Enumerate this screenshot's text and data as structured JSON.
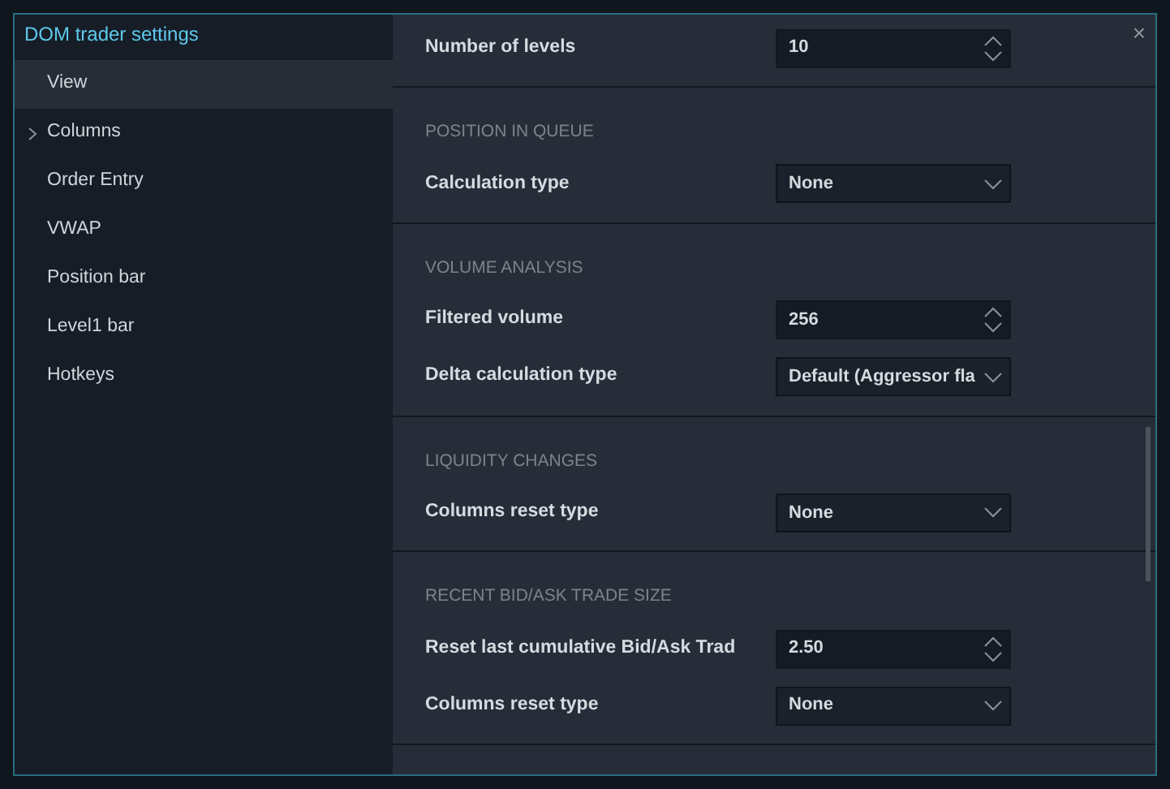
{
  "dialog": {
    "title": "DOM trader settings",
    "close": "×"
  },
  "sidebar": {
    "items": [
      {
        "label": "View",
        "selected": true,
        "expandable": false
      },
      {
        "label": "Columns",
        "selected": false,
        "expandable": true
      },
      {
        "label": "Order Entry",
        "selected": false,
        "expandable": false
      },
      {
        "label": "VWAP",
        "selected": false,
        "expandable": false
      },
      {
        "label": "Position bar",
        "selected": false,
        "expandable": false
      },
      {
        "label": "Level1 bar",
        "selected": false,
        "expandable": false
      },
      {
        "label": "Hotkeys",
        "selected": false,
        "expandable": false
      }
    ]
  },
  "sections": [
    {
      "fields": [
        {
          "label": "Number of levels",
          "kind": "spinner",
          "value": "10"
        }
      ]
    },
    {
      "header": "POSITION IN QUEUE",
      "fields": [
        {
          "label": "Calculation type",
          "kind": "dropdown",
          "value": "None"
        }
      ]
    },
    {
      "header": "VOLUME ANALYSIS",
      "fields": [
        {
          "label": "Filtered volume",
          "kind": "spinner",
          "value": "256"
        },
        {
          "label": "Delta calculation type",
          "kind": "dropdown",
          "value": "Default (Aggressor fla"
        }
      ]
    },
    {
      "header": "LIQUIDITY CHANGES",
      "fields": [
        {
          "label": "Columns reset type",
          "kind": "dropdown",
          "value": "None"
        }
      ]
    },
    {
      "header": "RECENT BID/ASK TRADE SIZE",
      "fields": [
        {
          "label": "Reset last cumulative Bid/Ask Trad",
          "kind": "spinner",
          "value": "2.50"
        },
        {
          "label": "Columns reset type",
          "kind": "dropdown",
          "value": "None"
        }
      ]
    }
  ]
}
